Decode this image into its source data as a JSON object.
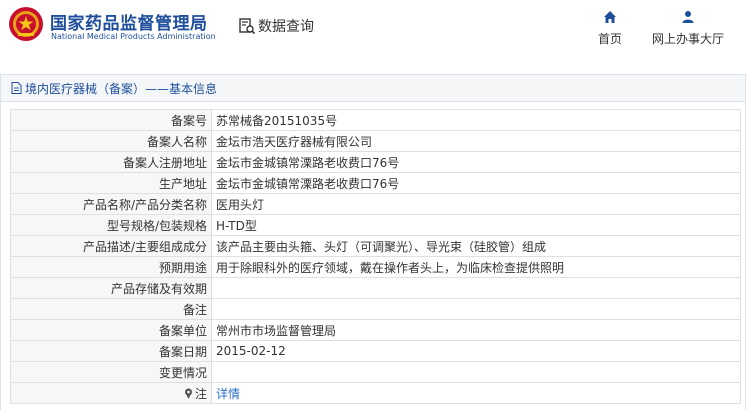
{
  "header": {
    "brand_cn": "国家药品监督管理局",
    "brand_en": "National Medical Products Administration",
    "query_label": "数据查询",
    "nav": [
      {
        "label": "首页",
        "icon": "home-icon"
      },
      {
        "label": "网上办事大厅",
        "icon": "user-icon"
      }
    ]
  },
  "panel": {
    "title": "境内医疗器械（备案）——基本信息"
  },
  "rows": [
    {
      "label": "备案号",
      "value": "苏常械备20151035号"
    },
    {
      "label": "备案人名称",
      "value": "金坛市浩天医疗器械有限公司"
    },
    {
      "label": "备案人注册地址",
      "value": "金坛市金城镇常溧路老收费口76号"
    },
    {
      "label": "生产地址",
      "value": "金坛市金城镇常溧路老收费口76号"
    },
    {
      "label": "产品名称/产品分类名称",
      "value": "医用头灯"
    },
    {
      "label": "型号规格/包装规格",
      "value": "H-TD型"
    },
    {
      "label": "产品描述/主要组成成分",
      "value": "该产品主要由头箍、头灯（可调聚光）、导光束（硅胶管）组成"
    },
    {
      "label": "预期用途",
      "value": "用于除眼科外的医疗领域，戴在操作者头上，为临床检查提供照明"
    },
    {
      "label": "产品存储及有效期",
      "value": ""
    },
    {
      "label": "备注",
      "value": ""
    },
    {
      "label": "备案单位",
      "value": "常州市市场监督管理局"
    },
    {
      "label": "备案日期",
      "value": "2015-02-12"
    },
    {
      "label": "变更情况",
      "value": ""
    }
  ],
  "note_row": {
    "label": "注",
    "link": "详情",
    "icon": "pin-icon"
  },
  "colors": {
    "brand": "#1f4f9c",
    "link": "#2a6fc9",
    "label_bg": "#f7f7f7"
  }
}
